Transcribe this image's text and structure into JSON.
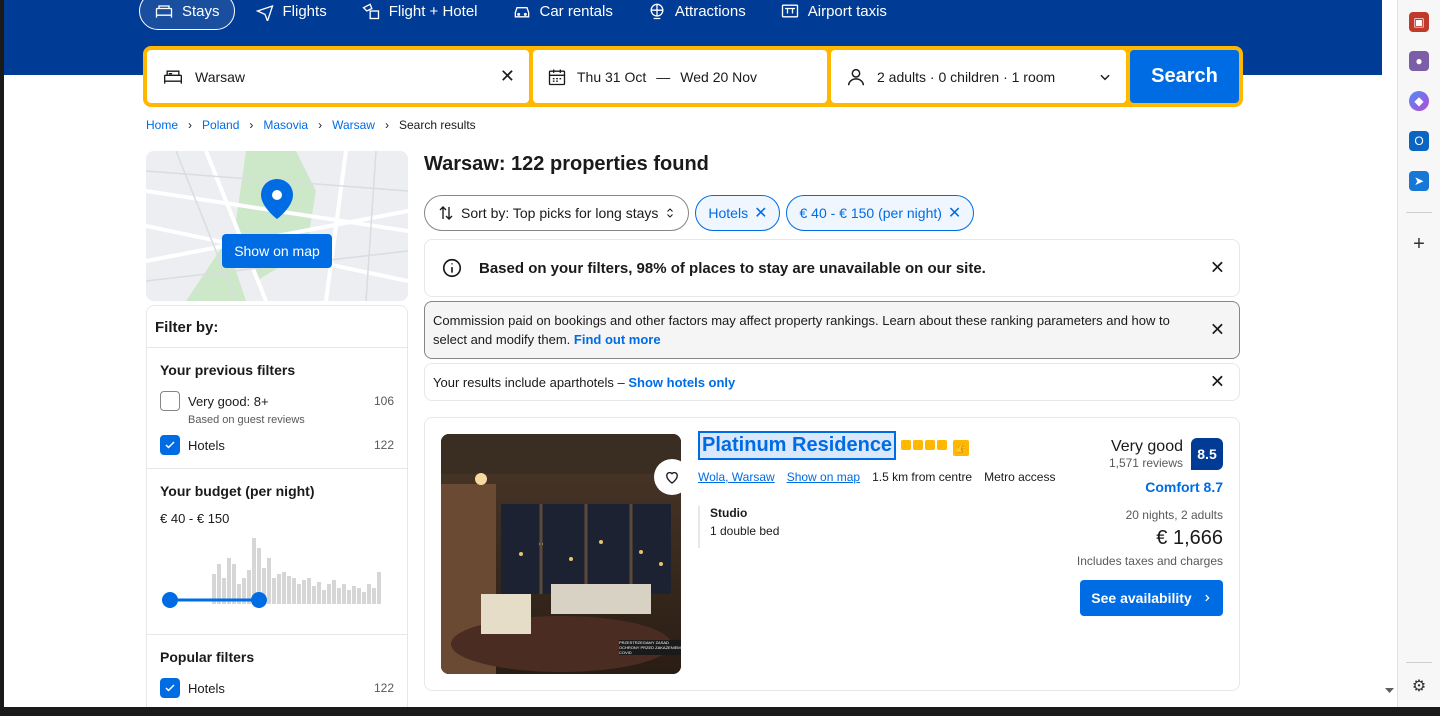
{
  "nav": {
    "items": [
      {
        "label": "Stays",
        "icon": "bed-icon",
        "active": true
      },
      {
        "label": "Flights",
        "icon": "plane-icon",
        "active": false
      },
      {
        "label": "Flight + Hotel",
        "icon": "plane-hotel-icon",
        "active": false
      },
      {
        "label": "Car rentals",
        "icon": "car-icon",
        "active": false
      },
      {
        "label": "Attractions",
        "icon": "attraction-icon",
        "active": false
      },
      {
        "label": "Airport taxis",
        "icon": "taxi-icon",
        "active": false
      }
    ]
  },
  "search": {
    "destination": "Warsaw",
    "check_in": "Thu 31 Oct",
    "dash": "—",
    "check_out": "Wed 20 Nov",
    "guests": "2 adults · 0 children · 1 room",
    "button": "Search"
  },
  "breadcrumb": {
    "items": [
      "Home",
      "Poland",
      "Masovia",
      "Warsaw"
    ],
    "current": "Search results"
  },
  "map": {
    "button": "Show on map"
  },
  "filters": {
    "title": "Filter by:",
    "previous": {
      "heading": "Your previous filters",
      "items": [
        {
          "label": "Very good: 8+",
          "count": "106",
          "sub": "Based on guest reviews",
          "checked": false
        },
        {
          "label": "Hotels",
          "count": "122",
          "checked": true
        }
      ]
    },
    "budget": {
      "heading": "Your budget (per night)",
      "value": "€ 40 - € 150",
      "range": [
        0.0,
        0.45
      ]
    },
    "popular": {
      "heading": "Popular filters",
      "items": [
        {
          "label": "Hotels",
          "count": "122",
          "checked": true
        }
      ]
    }
  },
  "results": {
    "title": "Warsaw: 122 properties found",
    "sort": "Sort by: Top picks for long stays",
    "chips": [
      "Hotels",
      "€ 40 - € 150 (per night)"
    ]
  },
  "notices": {
    "unavailable": "Based on your filters, 98% of places to stay are unavailable on our site.",
    "commission": "Commission paid on bookings and other factors may affect property rankings. Learn about these ranking parameters and how to select and modify them.",
    "commission_link": "Find out more",
    "aparthotels": "Your results include aparthotels –",
    "aparthotels_link": "Show hotels only"
  },
  "property": {
    "name": "Platinum Residence",
    "stars": 4,
    "location": "Wola, Warsaw",
    "show_on_map": "Show on map",
    "distance": "1.5 km from centre",
    "metro": "Metro access",
    "room_type": "Studio",
    "bed": "1 double bed",
    "rating_word": "Very good",
    "reviews": "1,571 reviews",
    "score": "8.5",
    "comfort": "Comfort 8.7",
    "nights": "20 nights, 2 adults",
    "price": "€ 1,666",
    "taxes": "Includes taxes and charges",
    "cta": "See availability",
    "image_caption": "PRZESTRZEGAMY ZASAD OCHRONY PRZED ZAKAŻENIEM COVID"
  },
  "colors": {
    "brand_blue": "#003b95",
    "action_blue": "#006ce4",
    "search_yellow": "#ffb700"
  }
}
